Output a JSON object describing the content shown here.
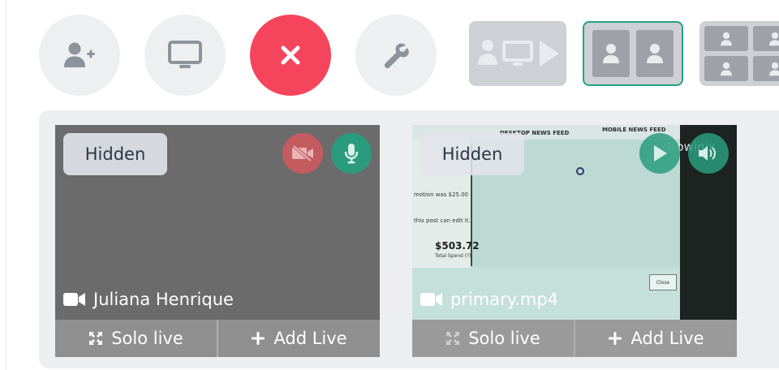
{
  "toolbar": {
    "buttons": [
      {
        "name": "add-guest-button",
        "icon": "user-plus-icon"
      },
      {
        "name": "share-screen-button",
        "icon": "monitor-icon"
      },
      {
        "name": "end-session-button",
        "icon": "close-icon",
        "color": "#f5455c"
      },
      {
        "name": "settings-button",
        "icon": "wrench-icon"
      }
    ],
    "layouts": [
      {
        "name": "layout-presenter-screen-play",
        "selected": false
      },
      {
        "name": "layout-two-side-by-side",
        "selected": true,
        "accent": "#26a286"
      },
      {
        "name": "layout-grid-four",
        "selected": false
      }
    ]
  },
  "cards": [
    {
      "visibility_label": "Hidden",
      "camera_status": "video-off",
      "mic_status": "on",
      "source_label": "Juliana Henrique",
      "actions": {
        "solo": "Solo live",
        "add": "Add Live"
      }
    },
    {
      "visibility_label": "Hidden",
      "playback": "play",
      "volume": "on",
      "source_label": "primary.mp4",
      "actions": {
        "solo": "Solo live",
        "add": "Add Live"
      },
      "video_text": {
        "header_left": "DESKTOP NEWS FEED",
        "header_right": "MOBILE NEWS FEED",
        "watermark": "Growinix",
        "note": "motion was $25.00",
        "note2": "this post can edit it.",
        "amount": "$503.72",
        "amount_label": "Total Spend (?)",
        "close_label": "Close"
      }
    }
  ],
  "colors": {
    "accent": "#26a286",
    "danger": "#f5455c"
  }
}
